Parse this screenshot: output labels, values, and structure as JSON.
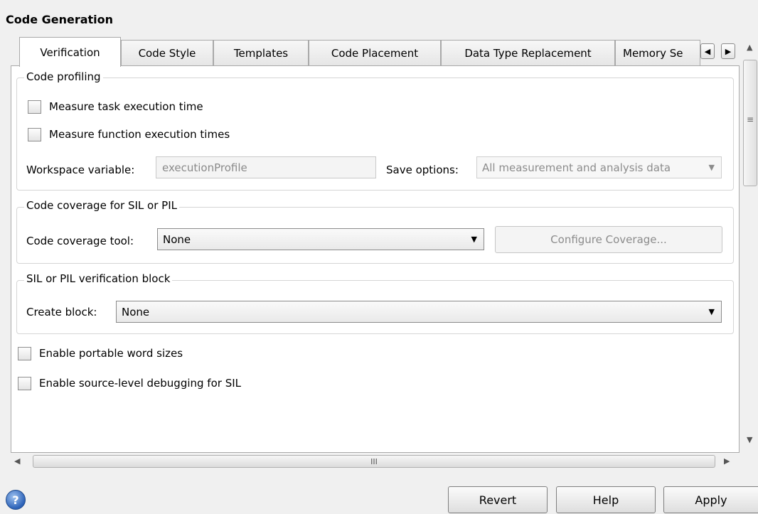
{
  "header": {
    "title": "Code Generation"
  },
  "tabs": [
    {
      "label": "Verification"
    },
    {
      "label": "Code Style"
    },
    {
      "label": "Templates"
    },
    {
      "label": "Code Placement"
    },
    {
      "label": "Data Type Replacement"
    },
    {
      "label": "Memory Se"
    }
  ],
  "tab_nav": {
    "prev": "◀",
    "next": "▶"
  },
  "profiling": {
    "legend": "Code profiling",
    "measure_task": "Measure task execution time",
    "measure_function": "Measure function execution times",
    "workspace_label": "Workspace variable:",
    "workspace_value": "executionProfile",
    "save_label": "Save options:",
    "save_value": "All measurement and analysis data"
  },
  "coverage": {
    "legend": "Code coverage for SIL or PIL",
    "tool_label": "Code coverage tool:",
    "tool_value": "None",
    "configure_button": "Configure Coverage..."
  },
  "verification_block": {
    "legend": "SIL or PIL verification block",
    "create_label": "Create block:",
    "create_value": "None"
  },
  "options": {
    "portable_word_sizes": "Enable portable word sizes",
    "source_debugging": "Enable source-level debugging for SIL"
  },
  "scroll": {
    "hthumb_grip": "III",
    "vthumb_grip": "≡",
    "up": "▲",
    "down": "▼",
    "left": "◀",
    "right": "▶"
  },
  "footer": {
    "help_icon_glyph": "?",
    "revert": "Revert",
    "help": "Help",
    "apply": "Apply"
  },
  "colors": {
    "help_icon": "#2c62b8",
    "panel_bg": "#ffffff",
    "window_bg": "#f0f0f0"
  }
}
